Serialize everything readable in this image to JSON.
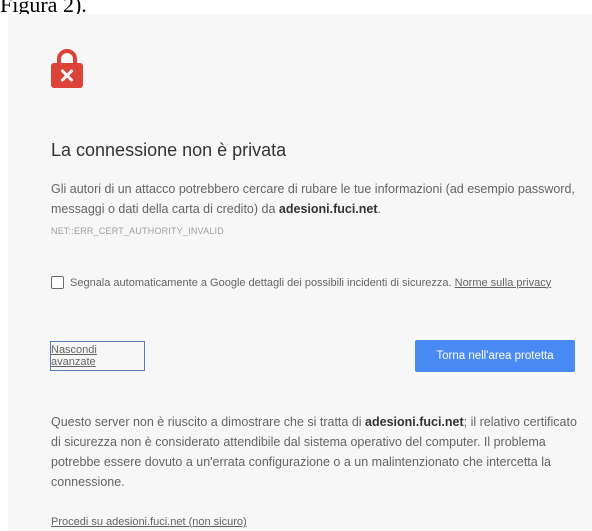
{
  "document_fragment": "Figura 2).",
  "interstitial": {
    "lock_icon": "lock-error-icon",
    "accent_color": "#db4437",
    "title": "La connessione non è privata",
    "description": {
      "before": "Gli autori di un attacco potrebbero cercare di rubare le tue informazioni (ad esempio password, messaggi o dati della carta di credito) da ",
      "domain": "adesioni.fuci.net",
      "after": "."
    },
    "error_code": "NET::ERR_CERT_AUTHORITY_INVALID",
    "report": {
      "checked": false,
      "text": "Segnala automaticamente a Google dettagli dei possibili incidenti di sicurezza. ",
      "privacy_link": "Norme sulla privacy"
    },
    "buttons": {
      "advanced": "Nascondi avanzate",
      "back": "Torna nell'area protetta",
      "back_color": "#4a8af4"
    },
    "details": {
      "before": "Questo server non è riuscito a dimostrare che si tratta di ",
      "domain": "adesioni.fuci.net",
      "after": "; il relativo certificato di sicurezza non è considerato attendibile dal sistema operativo del computer. Il problema potrebbe essere dovuto a un'errata configurazione o a un malintenzionato che intercetta la connessione."
    },
    "proceed_link": "Procedi su adesioni.fuci.net (non sicuro)"
  }
}
